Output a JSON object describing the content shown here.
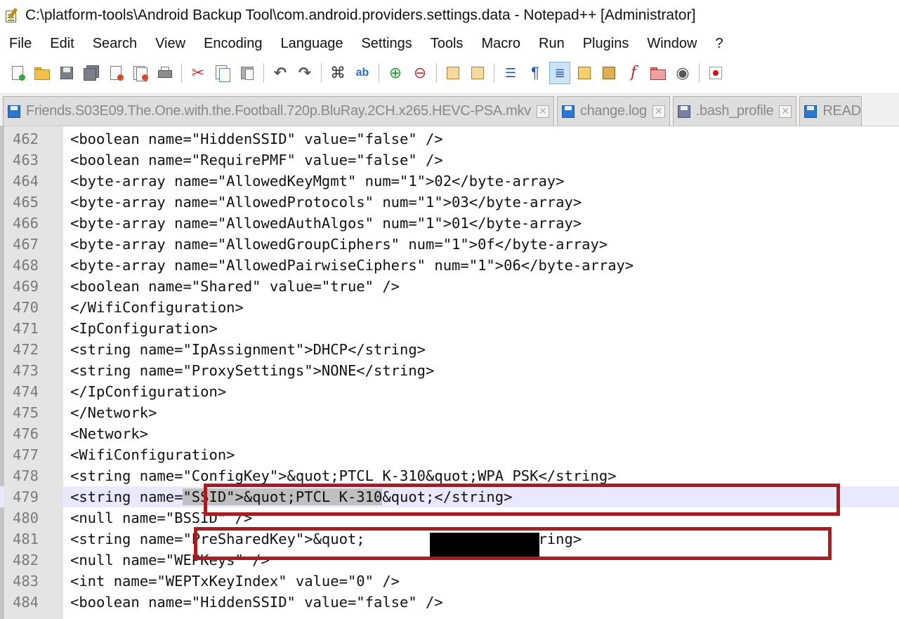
{
  "window": {
    "title": "C:\\platform-tools\\Android Backup Tool\\com.android.providers.settings.data - Notepad++ [Administrator]"
  },
  "menu": [
    "File",
    "Edit",
    "Search",
    "View",
    "Encoding",
    "Language",
    "Settings",
    "Tools",
    "Macro",
    "Run",
    "Plugins",
    "Window",
    "?"
  ],
  "toolbar": {
    "buttons": [
      "new-file-icon",
      "open-file-icon",
      "save-icon",
      "save-all-icon",
      "close-icon",
      "close-all-icon",
      "print-icon",
      "cut-icon",
      "copy-icon",
      "paste-icon",
      "undo-icon",
      "redo-icon",
      "find-icon",
      "replace-icon",
      "zoom-in-icon",
      "zoom-out-icon",
      "sync-vertical-icon",
      "sync-horizontal-icon",
      "word-wrap-icon",
      "show-all-characters-icon",
      "indent-guide-icon",
      "user-defined-language-icon",
      "document-map-icon",
      "function-list-icon",
      "folder-as-workspace-icon",
      "monitoring-icon",
      "start-recording-icon"
    ]
  },
  "tabs": [
    {
      "label": "Friends.S03E09.The.One.with.the.Football.720p.BluRay.2CH.x265.HEVC-PSA.mkv"
    },
    {
      "label": "change.log"
    },
    {
      "label": ".bash_profile"
    },
    {
      "label": "READ"
    }
  ],
  "editor": {
    "lines": [
      {
        "num": "462",
        "code": "<boolean name=\"HiddenSSID\" value=\"false\" />"
      },
      {
        "num": "463",
        "code": "<boolean name=\"RequirePMF\" value=\"false\" />"
      },
      {
        "num": "464",
        "code": "<byte-array name=\"AllowedKeyMgmt\" num=\"1\">02</byte-array>"
      },
      {
        "num": "465",
        "code": "<byte-array name=\"AllowedProtocols\" num=\"1\">03</byte-array>"
      },
      {
        "num": "466",
        "code": "<byte-array name=\"AllowedAuthAlgos\" num=\"1\">01</byte-array>"
      },
      {
        "num": "467",
        "code": "<byte-array name=\"AllowedGroupCiphers\" num=\"1\">0f</byte-array>"
      },
      {
        "num": "468",
        "code": "<byte-array name=\"AllowedPairwiseCiphers\" num=\"1\">06</byte-array>"
      },
      {
        "num": "469",
        "code": "<boolean name=\"Shared\" value=\"true\" />"
      },
      {
        "num": "470",
        "code": "</WifiConfiguration>"
      },
      {
        "num": "471",
        "code": "<IpConfiguration>"
      },
      {
        "num": "472",
        "code": "<string name=\"IpAssignment\">DHCP</string>"
      },
      {
        "num": "473",
        "code": "<string name=\"ProxySettings\">NONE</string>"
      },
      {
        "num": "474",
        "code": "</IpConfiguration>"
      },
      {
        "num": "475",
        "code": "</Network>"
      },
      {
        "num": "476",
        "code": "<Network>"
      },
      {
        "num": "477",
        "code": "<WifiConfiguration>"
      },
      {
        "num": "478",
        "code": "<string name=\"ConfigKey\">&quot;PTCL K-310&quot;WPA_PSK</string>"
      },
      {
        "num": "479",
        "code": "<string name=\"SSID\">&quot;PTCL K-310&quot;</string>"
      },
      {
        "num": "480",
        "code": "<null name=\"BSSID\" />"
      },
      {
        "num": "481",
        "code": "<string name=\"PreSharedKey\">&quot;           quot;</string>"
      },
      {
        "num": "482",
        "code": "<null name=\"WEPKeys\" />"
      },
      {
        "num": "483",
        "code": "<int name=\"WEPTxKeyIndex\" value=\"0\" />"
      },
      {
        "num": "484",
        "code": "<boolean name=\"HiddenSSID\" value=\"false\" />"
      }
    ],
    "current_line": "479",
    "selected_text": "\"SSID\">&quot;PTCL K-310"
  },
  "annotation_color": "#a51e22"
}
